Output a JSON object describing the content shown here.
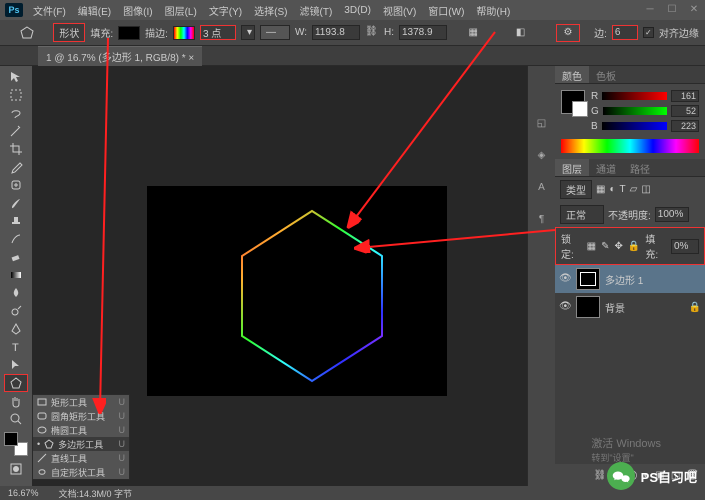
{
  "menu": {
    "items": [
      "文件(F)",
      "编辑(E)",
      "图像(I)",
      "图层(L)",
      "文字(Y)",
      "选择(S)",
      "滤镜(T)",
      "3D(D)",
      "视图(V)",
      "窗口(W)",
      "帮助(H)"
    ]
  },
  "options": {
    "shape_label": "形状",
    "fill_label": "填充:",
    "stroke_label": "描边:",
    "stroke_value": "3 点",
    "w_label": "W:",
    "w_value": "1193.8",
    "h_label": "H:",
    "h_value": "1378.9",
    "sides_label": "边:",
    "sides_value": "6",
    "align_stroke": "对齐边缘"
  },
  "doc": {
    "tab_title": "1 @ 16.7% (多边形 1, RGB/8) *"
  },
  "flyout": {
    "items": [
      {
        "label": "矩形工具",
        "key": "U"
      },
      {
        "label": "圆角矩形工具",
        "key": "U"
      },
      {
        "label": "椭圆工具",
        "key": "U"
      },
      {
        "label": "多边形工具",
        "key": "U"
      },
      {
        "label": "直线工具",
        "key": "U"
      },
      {
        "label": "自定形状工具",
        "key": "U"
      }
    ],
    "active_index": 3
  },
  "color_panel": {
    "tab1": "颜色",
    "tab2": "色板",
    "r_label": "R",
    "r_value": "161",
    "g_label": "G",
    "g_value": "52",
    "b_label": "B",
    "b_value": "223"
  },
  "layers_panel": {
    "tab1": "图层",
    "tab2": "通道",
    "tab3": "路径",
    "kind_label": "类型",
    "mode": "正常",
    "opacity_label": "不透明度:",
    "opacity_value": "100%",
    "lock_label": "锁定:",
    "fill_label": "填充:",
    "fill_value": "0%",
    "layer1": "多边形 1",
    "layer2": "背景"
  },
  "status": {
    "zoom": "16.67%",
    "doc_info": "文档:14.3M/0 字节"
  },
  "watermark": {
    "activate_title": "激活 Windows",
    "activate_sub": "转到\"设置\"",
    "brand": "PS自习吧"
  }
}
